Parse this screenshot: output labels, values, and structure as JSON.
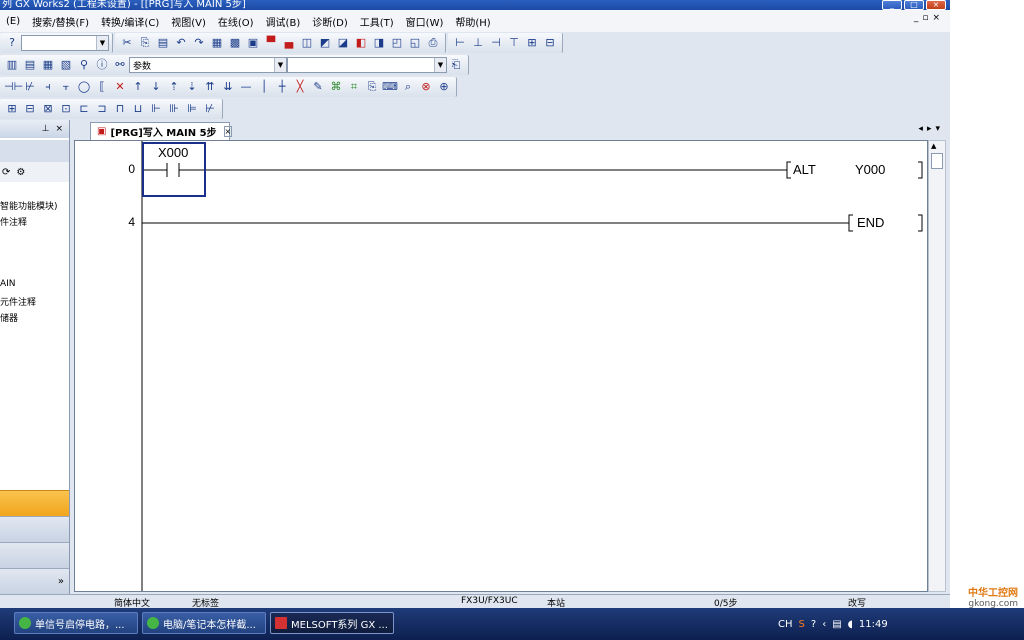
{
  "title_bar": {
    "title": "列 GX Works2 (工程未设置) - [[PRG]写入 MAIN 5步]"
  },
  "menu": {
    "items": [
      "(E)",
      "搜索/替换(F)",
      "转换/编译(C)",
      "视图(V)",
      "在线(O)",
      "调试(B)",
      "诊断(D)",
      "工具(T)",
      "窗口(W)",
      "帮助(H)"
    ]
  },
  "toolbar": {
    "parameter_combo_value": "参数"
  },
  "navigation": {
    "tree_items": [
      "智能功能模块)",
      "件注释",
      "AIN",
      "元件注释",
      "储器"
    ],
    "expand_glyph": "»"
  },
  "document_tab": {
    "label": "[PRG]写入 MAIN 5步"
  },
  "ladder": {
    "rungs": [
      {
        "step": "0",
        "contact": "X000",
        "instruction": "ALT",
        "operand": "Y000"
      },
      {
        "step": "4",
        "instruction": "END"
      }
    ]
  },
  "status_bar": {
    "language": "简体中文",
    "label": "无标签",
    "plc_type": "FX3U/FX3UC",
    "station": "本站",
    "steps": "0/5步",
    "mode": "改写"
  },
  "taskbar": {
    "tasks": [
      "单信号启停电路，...",
      "电脑/笔记本怎样截...",
      "MELSOFT系列 GX ..."
    ],
    "tray_lang": "CH",
    "clock": "11:49"
  },
  "watermark": {
    "brand": "中华工控网",
    "url": "gkong.com"
  }
}
